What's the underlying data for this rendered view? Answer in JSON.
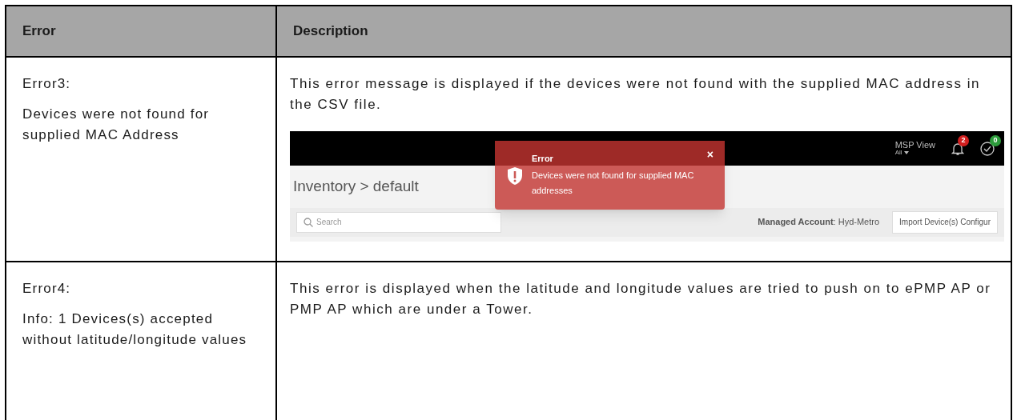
{
  "table": {
    "columns": [
      "Error",
      "Description"
    ],
    "rows": [
      {
        "error_lines": [
          "Error3:",
          "Devices were not found for supplied  MAC Address"
        ],
        "description": "This error message is displayed if the devices were not found with the supplied MAC address in  the CSV file.",
        "screenshot": {
          "msp_view": "MSP View",
          "msp_filter": "All",
          "alerts_count": "2",
          "checks_count": "0",
          "breadcrumb": "Inventory > default",
          "search_placeholder": "Search",
          "managed_account": "**Managed Account**: Hyd-Metro",
          "import_button": "Import Device(s) Configur",
          "toast": {
            "title": "Error",
            "message": "Devices were not found for supplied MAC addresses",
            "close": "×"
          }
        }
      },
      {
        "error_lines": [
          "Error4:",
          "Info: 1 Devices(s) accepted without latitude/longitude values"
        ],
        "description": "This error is displayed when the latitude and longitude values are tried to push on to ePMP AP or PMP AP which are under a Tower."
      }
    ]
  }
}
